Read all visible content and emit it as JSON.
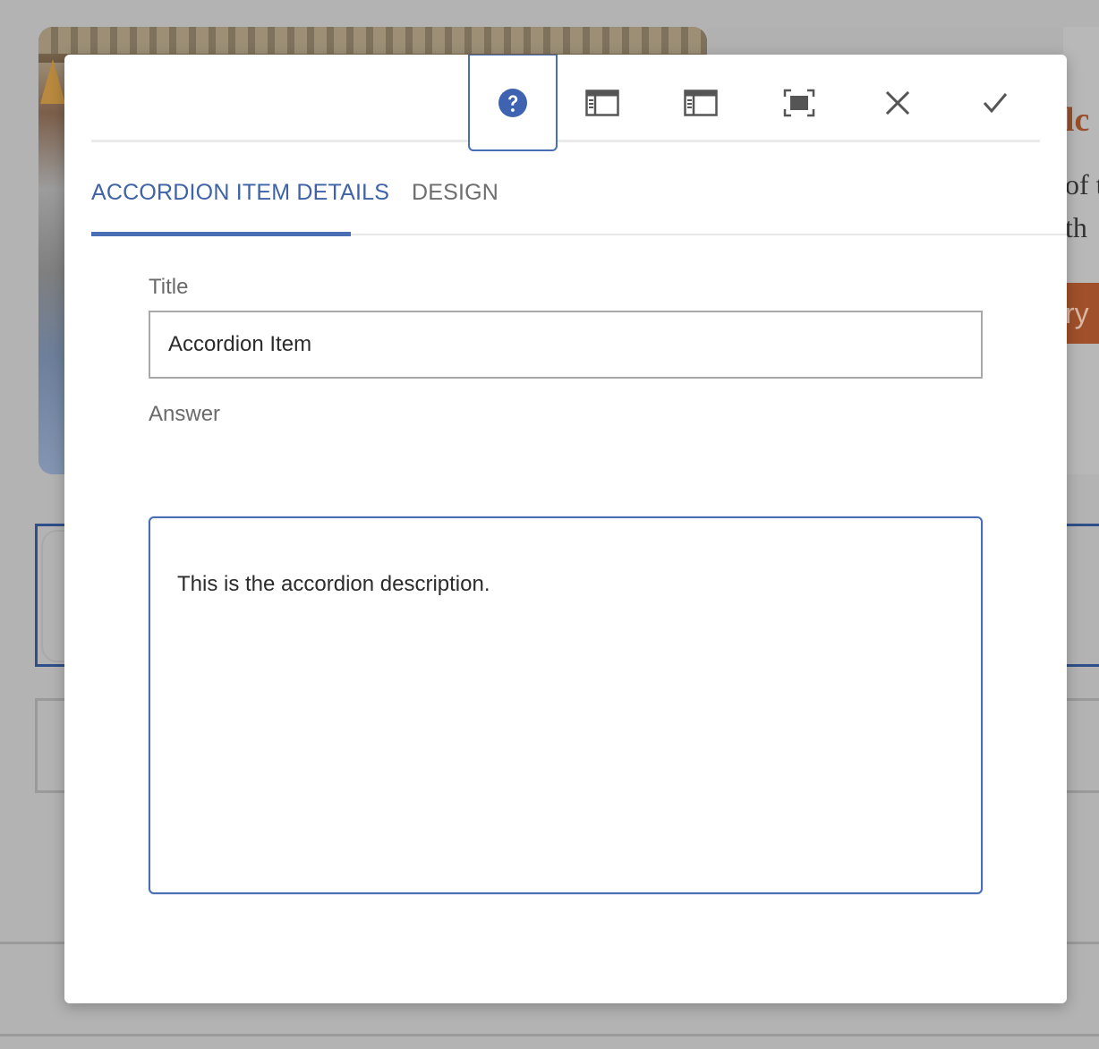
{
  "background": {
    "title_fragment": "lc",
    "line1_fragment": "of t",
    "line2_fragment": "th",
    "button_fragment": "ry"
  },
  "toolbar": {
    "buttons": [
      {
        "icon": "help-circle-icon",
        "active": true
      },
      {
        "icon": "panel-left-icon"
      },
      {
        "icon": "panel-left-alt-icon"
      },
      {
        "icon": "fullscreen-icon"
      },
      {
        "icon": "close-icon"
      },
      {
        "icon": "checkmark-icon"
      }
    ]
  },
  "tabs": {
    "details_label": "ACCORDION ITEM DETAILS",
    "design_label": "DESIGN"
  },
  "form": {
    "title_label": "Title",
    "title_value": "Accordion Item",
    "answer_label": "Answer",
    "answer_text": "This is the accordion description."
  },
  "colors": {
    "accent": "#4a6eb5",
    "tab_active_text": "#3f63a6",
    "help_icon": "#3e63b0"
  }
}
